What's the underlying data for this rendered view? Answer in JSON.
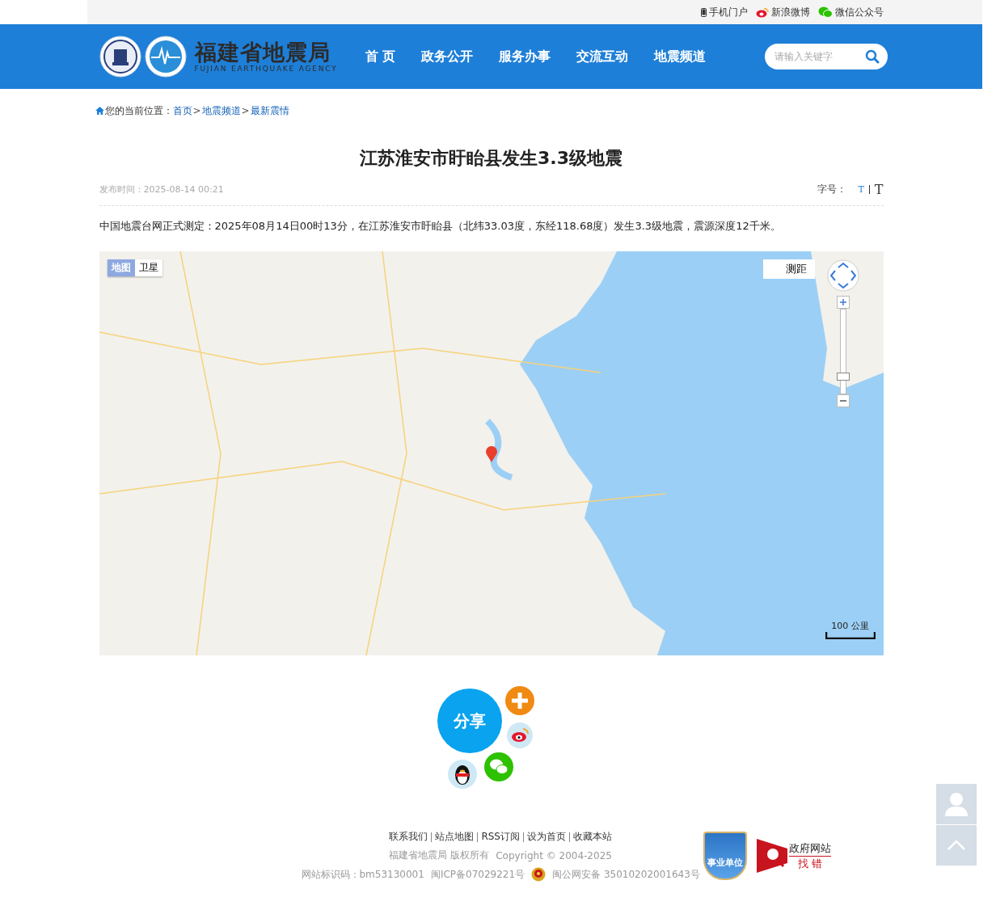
{
  "top_bar": {
    "links": [
      "手机门户",
      "新浪微博",
      "微信公众号"
    ]
  },
  "header": {
    "title": "福建省地震局",
    "subtitle": "FUJIAN EARTHQUAKE AGENCY",
    "nav": [
      "首 页",
      "政务公开",
      "服务办事",
      "交流互动",
      "地震频道"
    ],
    "search": {
      "placeholder": "请输入关键字"
    }
  },
  "breadcrumb": {
    "label": "您的当前位置：",
    "separator": ">",
    "items": [
      "首页",
      "地震频道",
      "最新震情"
    ]
  },
  "article": {
    "title": "江苏淮安市盱眙县发生3.3级地震",
    "published": "发布时间：2025-08-14 00:21",
    "font_size": {
      "label": "字号：",
      "options": [
        {
          "label": "T",
          "selected": true
        },
        {
          "label": "T",
          "selected": false
        }
      ]
    },
    "body": "中国地震台网正式测定：2025年08月14日00时13分，在江苏淮安市盱眙县（北纬33.03度，东经118.68度）发生3.3级地震，震源深度12千米。"
  },
  "map": {
    "types": [
      {
        "label": "地图",
        "selected": true
      },
      {
        "label": "卫星",
        "selected": false
      }
    ],
    "measure": "测距",
    "zoom": {
      "level": 0.17
    },
    "scale": "100 公里"
  },
  "share": {
    "label": "分享"
  },
  "footer": {
    "links": [
      "联系我们",
      "站点地图",
      "RSS订阅",
      "设为首页",
      "收藏本站"
    ],
    "copyright": [
      "福建省地震局  版权所有",
      "Copyright © 2004-2025"
    ],
    "site_id": "网站标识码：bm53130001",
    "icp": "闽ICP备07029221号",
    "police": "闽公网安备 35010202001643号",
    "badge": "事业单位",
    "gov_check": [
      "政府网站",
      "找 错"
    ]
  }
}
